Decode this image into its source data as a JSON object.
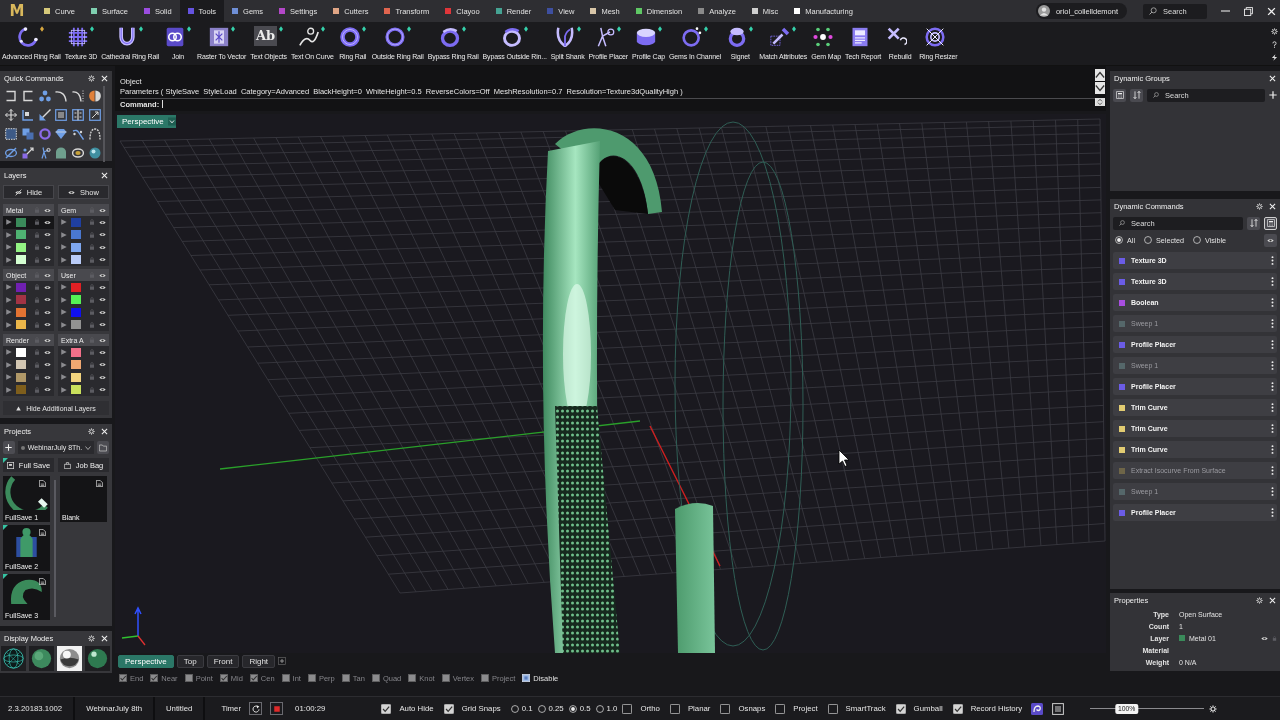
{
  "menu_bar": {
    "logo": "M",
    "tabs": [
      {
        "label": "Curve",
        "color": "#d6c97a",
        "selected": false
      },
      {
        "label": "Surface",
        "color": "#7fcfb0",
        "selected": false
      },
      {
        "label": "Solid",
        "color": "#9b4de0",
        "selected": false
      },
      {
        "label": "Tools",
        "color": "#6553e0",
        "selected": true
      },
      {
        "label": "Gems",
        "color": "#6f8fd6",
        "selected": false
      },
      {
        "label": "Settings",
        "color": "#b347c8",
        "selected": false
      },
      {
        "label": "Cutters",
        "color": "#e0a585",
        "selected": false
      },
      {
        "label": "Transform",
        "color": "#e0654f",
        "selected": false
      },
      {
        "label": "Clayoo",
        "color": "#e0363a",
        "selected": false
      },
      {
        "label": "Render",
        "color": "#45a393",
        "selected": false
      },
      {
        "label": "View",
        "color": "#3e4fa0",
        "selected": false
      },
      {
        "label": "Mesh",
        "color": "#d8c6a8",
        "selected": false
      },
      {
        "label": "Dimension",
        "color": "#5fc865",
        "selected": false
      },
      {
        "label": "Analyze",
        "color": "#8a8a8a",
        "selected": false
      },
      {
        "label": "Misc",
        "color": "#cfcfcf",
        "selected": false
      },
      {
        "label": "Manufacturing",
        "color": "#ffffff",
        "selected": false
      }
    ],
    "user": {
      "name": "oriol_collelldemont"
    },
    "search": {
      "placeholder": "Search"
    }
  },
  "toolbar": {
    "tools": [
      {
        "label": "Advanced Ring Rail",
        "flagged": true,
        "color": "#d8a840"
      },
      {
        "label": "Texture 3D",
        "flagged": true,
        "color": "#35d3ad"
      },
      {
        "label": "Cathedral Ring Rail",
        "flagged": true,
        "color": "#35d3ad"
      },
      {
        "label": "Join",
        "flagged": true,
        "color": "#35d3ad"
      },
      {
        "label": "Raster To Vector",
        "flagged": true,
        "color": "#35d3ad"
      },
      {
        "label": "Text Objects",
        "glyph": "Ab",
        "flagged": true,
        "color": "#35d3ad"
      },
      {
        "label": "Text On Curve",
        "flagged": true,
        "color": "#35d3ad"
      },
      {
        "label": "Ring Rail",
        "flagged": true,
        "color": "#35d3ad"
      },
      {
        "label": "Outside Ring Rail",
        "flagged": true,
        "color": "#35d3ad"
      },
      {
        "label": "Bypass Ring Rail",
        "flagged": true,
        "color": "#35d3ad"
      },
      {
        "label": "Bypass Outside Rin...",
        "flagged": true,
        "color": "#35d3ad"
      },
      {
        "label": "Split Shank",
        "flagged": true,
        "color": "#35d3ad"
      },
      {
        "label": "Profile Placer",
        "flagged": true,
        "color": "#35d3ad"
      },
      {
        "label": "Profile Cap",
        "flagged": true,
        "color": "#35d3ad"
      },
      {
        "label": "Gems In Channel",
        "flagged": true,
        "color": "#35d3ad"
      },
      {
        "label": "Signet",
        "flagged": true,
        "color": "#35d3ad"
      },
      {
        "label": "Match Attributes",
        "flagged": true,
        "color": "#35d3ad"
      },
      {
        "label": "Gem Map",
        "flagged": false
      },
      {
        "label": "Tech Report",
        "flagged": false
      },
      {
        "label": "Rebuild",
        "flagged": false
      },
      {
        "label": "Ring Resizer",
        "flagged": false
      }
    ]
  },
  "quick_commands": {
    "title": "Quick Commands"
  },
  "layers": {
    "title": "Layers",
    "buttons": [
      {
        "label": "Hide",
        "kind": "hide"
      },
      {
        "label": "Show",
        "kind": "show"
      }
    ],
    "groups": [
      {
        "name": "Metal",
        "rows": [
          {
            "color": "#3a8a5a",
            "selected": true
          },
          {
            "color": "#4fb272",
            "selected": false
          },
          {
            "color": "#93f383",
            "selected": false
          },
          {
            "color": "#d4ffd2",
            "selected": false
          }
        ]
      },
      {
        "name": "Gem",
        "rows": [
          {
            "color": "#1f3fa0",
            "selected": false
          },
          {
            "color": "#4a78d0",
            "selected": false
          },
          {
            "color": "#7fa8f0",
            "selected": false
          },
          {
            "color": "#b9cbf7",
            "selected": false
          }
        ]
      },
      {
        "name": "Object",
        "rows": [
          {
            "color": "#7020b0",
            "selected": false
          },
          {
            "color": "#a33344",
            "selected": false
          },
          {
            "color": "#e37332",
            "selected": false
          },
          {
            "color": "#ebb64a",
            "selected": false
          }
        ]
      },
      {
        "name": "User",
        "rows": [
          {
            "color": "#e02024",
            "selected": false
          },
          {
            "color": "#55f055",
            "selected": false
          },
          {
            "color": "#1010f0",
            "selected": false
          },
          {
            "color": "#929292",
            "selected": false
          }
        ]
      },
      {
        "name": "Render",
        "rows": [
          {
            "color": "#ffffff",
            "selected": false
          },
          {
            "color": "#d2c6b2",
            "selected": false
          },
          {
            "color": "#b09868",
            "selected": false
          },
          {
            "color": "#7e5e1c",
            "selected": false
          }
        ]
      },
      {
        "name": "Extra A",
        "rows": [
          {
            "color": "#f2708a",
            "selected": false
          },
          {
            "color": "#f0a872",
            "selected": false
          },
          {
            "color": "#f1d37e",
            "selected": false
          },
          {
            "color": "#c9e05c",
            "selected": false
          }
        ]
      }
    ],
    "footer": "Hide Additional Layers"
  },
  "projects": {
    "title": "Projects",
    "project": "WebinarJuly 8Th.",
    "buttons": [
      {
        "label": "Full Save",
        "kind": "save",
        "flagged": true
      },
      {
        "label": "Job Bag",
        "kind": "bag",
        "flagged": false
      }
    ],
    "saves": [
      {
        "label": "FullSave 1",
        "flagged": false
      },
      {
        "label": "FullSave 2",
        "flagged": true
      },
      {
        "label": "FullSave 3",
        "flagged": true
      }
    ],
    "templates": [
      {
        "label": "Blank"
      }
    ]
  },
  "display_modes": {
    "title": "Display Modes",
    "modes": [
      {
        "selected": false
      },
      {
        "selected": false
      },
      {
        "selected": true
      },
      {
        "selected": false
      }
    ]
  },
  "command_line": {
    "lines": [
      "Object",
      "Parameters ( StyleSave  StyleLoad  Category=Advanced  BlackHeight=0  WhiteHeight=0.5  ReverseColors=Off  MeshResolution=0.7  Resolution=Texture3dQualityHigh )"
    ],
    "prompt": "Command:"
  },
  "viewport": {
    "title": "Perspective",
    "tabs": [
      {
        "label": "Perspective",
        "selected": true
      },
      {
        "label": "Top",
        "selected": false
      },
      {
        "label": "Front",
        "selected": false
      },
      {
        "label": "Right",
        "selected": false
      }
    ]
  },
  "osnaps": {
    "items": [
      {
        "label": "End",
        "checked": true
      },
      {
        "label": "Near",
        "checked": true
      },
      {
        "label": "Point",
        "checked": false
      },
      {
        "label": "Mid",
        "checked": true
      },
      {
        "label": "Cen",
        "checked": true
      },
      {
        "label": "Int",
        "checked": false
      },
      {
        "label": "Perp",
        "checked": false
      },
      {
        "label": "Tan",
        "checked": false
      },
      {
        "label": "Quad",
        "checked": false
      },
      {
        "label": "Knot",
        "checked": false
      },
      {
        "label": "Vertex",
        "checked": false
      },
      {
        "label": "Project",
        "checked": false
      }
    ],
    "disable": {
      "label": "Disable",
      "checked": true
    }
  },
  "dynamic_groups": {
    "title": "Dynamic Groups",
    "search": {
      "placeholder": "Search"
    }
  },
  "dynamic_commands": {
    "title": "Dynamic Commands",
    "search": {
      "placeholder": "Search"
    },
    "filters": [
      {
        "label": "All",
        "selected": true
      },
      {
        "label": "Selected",
        "selected": false
      },
      {
        "label": "Visible",
        "selected": false
      }
    ],
    "items": [
      {
        "label": "Texture 3D",
        "color": "#6b5ce6",
        "disabled": false
      },
      {
        "label": "Texture 3D",
        "color": "#6b5ce6",
        "disabled": false
      },
      {
        "label": "Boolean",
        "color": "#a84ee0",
        "disabled": false
      },
      {
        "label": "Sweep 1",
        "color": "#55676a",
        "disabled": true
      },
      {
        "label": "Profile Placer",
        "color": "#6b5ce6",
        "disabled": false
      },
      {
        "label": "Sweep 1",
        "color": "#55676a",
        "disabled": true
      },
      {
        "label": "Profile Placer",
        "color": "#6b5ce6",
        "disabled": false
      },
      {
        "label": "Trim Curve",
        "color": "#e2cc72",
        "disabled": false
      },
      {
        "label": "Trim Curve",
        "color": "#e2cc72",
        "disabled": false
      },
      {
        "label": "Trim Curve",
        "color": "#e2cc72",
        "disabled": false
      },
      {
        "label": "Extract Isocurve From Surface",
        "color": "#6e6548",
        "disabled": true
      },
      {
        "label": "Sweep 1",
        "color": "#55676a",
        "disabled": true
      },
      {
        "label": "Profile Placer",
        "color": "#6b5ce6",
        "disabled": false
      }
    ]
  },
  "properties": {
    "title": "Properties",
    "rows": [
      {
        "kind": "text",
        "label": "Type",
        "value": "Open Surface"
      },
      {
        "kind": "text",
        "label": "Count",
        "value": "1"
      },
      {
        "kind": "layer",
        "label": "Layer",
        "value": "Metal 01",
        "color": "#3a8a5a"
      },
      {
        "kind": "text",
        "label": "Material"
      },
      {
        "kind": "text",
        "label": "Weight",
        "value": "0 N/A"
      }
    ]
  },
  "status_bar": {
    "version": "2.3.20183.1002",
    "project": "WebinarJuly 8th",
    "file": "Untitled",
    "timer": {
      "label": "Timer",
      "time": "01:00:29"
    },
    "toggles": [
      {
        "kind": "checkbox",
        "label": "Auto Hide",
        "checked": true
      },
      {
        "kind": "checkbox",
        "label": "Grid Snaps",
        "checked": true
      },
      {
        "kind": "radio",
        "label": "0.1",
        "selected": false
      },
      {
        "kind": "radio",
        "label": "0.25",
        "selected": false
      },
      {
        "kind": "radio",
        "label": "0.5",
        "selected": true
      },
      {
        "kind": "radio",
        "label": "1.0",
        "selected": false
      },
      {
        "kind": "checkbox",
        "label": "Ortho",
        "checked": false
      },
      {
        "kind": "checkbox",
        "label": "Planar",
        "checked": false
      },
      {
        "kind": "checkbox",
        "label": "Osnaps",
        "checked": false
      },
      {
        "kind": "checkbox",
        "label": "Project",
        "checked": false
      },
      {
        "kind": "checkbox",
        "label": "SmartTrack",
        "checked": false
      },
      {
        "kind": "checkbox",
        "label": "Gumball",
        "checked": true
      },
      {
        "kind": "checkbox",
        "label": "Record History",
        "checked": true
      }
    ],
    "zoom": {
      "label": "100%",
      "level": 0.32
    }
  }
}
